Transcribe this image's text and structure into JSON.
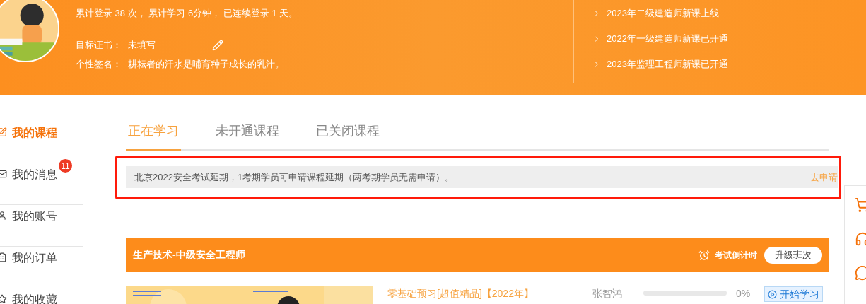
{
  "profile": {
    "stats": "累计登录 38 次， 累计学习 6分钟， 已连续登录 1 天。",
    "fields": [
      {
        "label": "目标证书：",
        "value": "未填写",
        "editable": true
      },
      {
        "label": "个性签名：",
        "value": "耕耘者的汗水是哺育种子成长的乳汁。",
        "editable": false
      }
    ]
  },
  "news": [
    {
      "text": "2023年二级建造师新课上线"
    },
    {
      "text": "2022年一级建造师新课已开通"
    },
    {
      "text": "2023年监理工程师新课已开通"
    }
  ],
  "sidebar": {
    "items": [
      {
        "label": "我的课程",
        "selected": true
      },
      {
        "label": "我的消息",
        "selected": false,
        "badge": "11"
      },
      {
        "label": "我的账号",
        "selected": false
      },
      {
        "label": "我的订单",
        "selected": false
      },
      {
        "label": "我的收藏",
        "selected": false
      }
    ]
  },
  "tabs": [
    {
      "label": "正在学习",
      "selected": true
    },
    {
      "label": "未开通课程",
      "selected": false
    },
    {
      "label": "已关闭课程",
      "selected": false
    }
  ],
  "notice": {
    "text": "北京2022安全考试延期，1考期学员可申请课程延期（两考期学员无需申请）。",
    "link": "去申请"
  },
  "course_group": {
    "title": "生产技术-中级安全工程师",
    "countdown": "考试倒计时",
    "upgrade": "升级班次",
    "courses": [
      {
        "title": "零基础预习[超值精品]【2022年】",
        "teacher": "张智鸿",
        "level": 0,
        "percent": "0%",
        "action": "开始学习"
      }
    ]
  }
}
